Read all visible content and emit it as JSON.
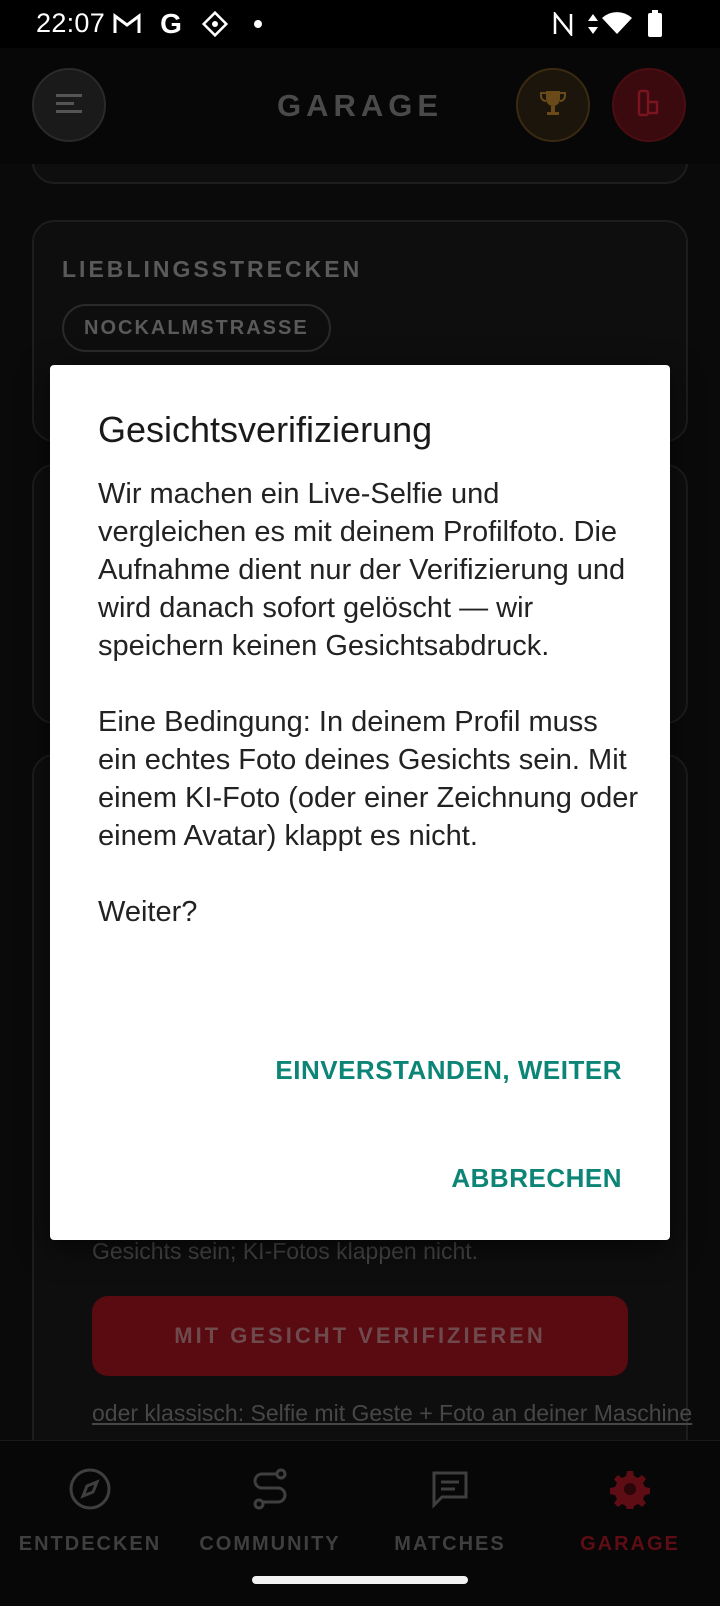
{
  "status_bar": {
    "time": "22:07",
    "icons": [
      "gmail-icon",
      "google-icon",
      "app-icon",
      "dot-icon",
      "nfc-icon",
      "data-arrows-icon",
      "wifi-icon",
      "battery-icon"
    ]
  },
  "app_bar": {
    "title": "GARAGE",
    "icons": [
      "menu-icon",
      "trophy-icon",
      "bike-icon"
    ]
  },
  "background": {
    "favorite_routes_title": "LIEBLINGSSTRECKEN",
    "route_chip": "NOCKALMSTRASSE",
    "hint_text": "Gesichts sein; KI-Fotos klappen nicht.",
    "verify_button": "MIT GESICHT VERIFIZIEREN",
    "classic_link": "oder klassisch: Selfie mit Geste + Foto an deiner Maschine"
  },
  "dialog": {
    "title": "Gesichtsverifizierung",
    "paragraph1": "Wir machen ein Live-Selfie und vergleichen es mit deinem Profilfoto. Die Aufnahme dient nur der Verifizierung und wird danach sofort gelöscht — wir speichern keinen Gesichtsabdruck.",
    "paragraph2": "Eine Bedingung: In deinem Profil muss ein echtes Foto deines Gesichts sein. Mit einem KI-Foto (oder einer Zeichnung oder einem Avatar) klappt es nicht.",
    "paragraph3": "Weiter?",
    "confirm_label": "EINVERSTANDEN, WEITER",
    "cancel_label": "ABBRECHEN"
  },
  "bottom_nav": {
    "items": [
      {
        "label": "ENTDECKEN",
        "icon": "compass-icon"
      },
      {
        "label": "COMMUNITY",
        "icon": "route-icon"
      },
      {
        "label": "MATCHES",
        "icon": "chat-icon"
      },
      {
        "label": "GARAGE",
        "icon": "gear-icon"
      }
    ],
    "active": "GARAGE"
  },
  "colors": {
    "accent_red": "#c8102e",
    "dialog_button": "#0c8577",
    "background": "#000000"
  }
}
